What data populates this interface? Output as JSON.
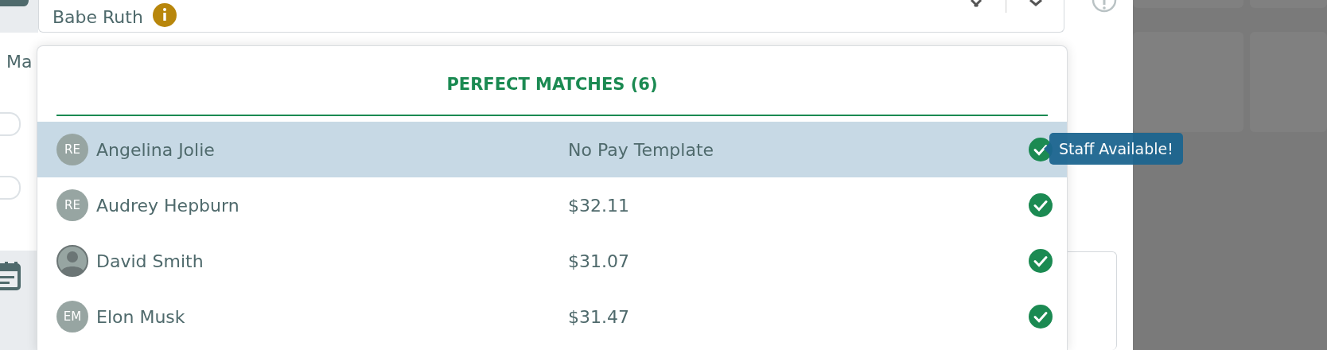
{
  "staff_field": {
    "value": "Babe Ruth"
  },
  "side_labels": [
    {
      "text": "Ma",
      "kind": "label"
    },
    {
      "kind": "toggle",
      "on": false
    },
    {
      "kind": "toggle",
      "on": false
    }
  ],
  "dropdown": {
    "heading": "PERFECT MATCHES (6)",
    "options": [
      {
        "name": "Angelina Jolie",
        "rate": "No Pay Template",
        "avatar": {
          "kind": "initials",
          "text": "RE"
        },
        "selected": true,
        "available": true
      },
      {
        "name": "Audrey Hepburn",
        "rate": "$32.11",
        "avatar": {
          "kind": "initials",
          "text": "RE"
        },
        "selected": false,
        "available": true
      },
      {
        "name": "David Smith",
        "rate": "$31.07",
        "avatar": {
          "kind": "photo"
        },
        "selected": false,
        "available": true
      },
      {
        "name": "Elon Musk",
        "rate": "$31.47",
        "avatar": {
          "kind": "initials",
          "text": "EM"
        },
        "selected": false,
        "available": true
      }
    ]
  },
  "tooltip": {
    "text": "Staff Available!"
  }
}
